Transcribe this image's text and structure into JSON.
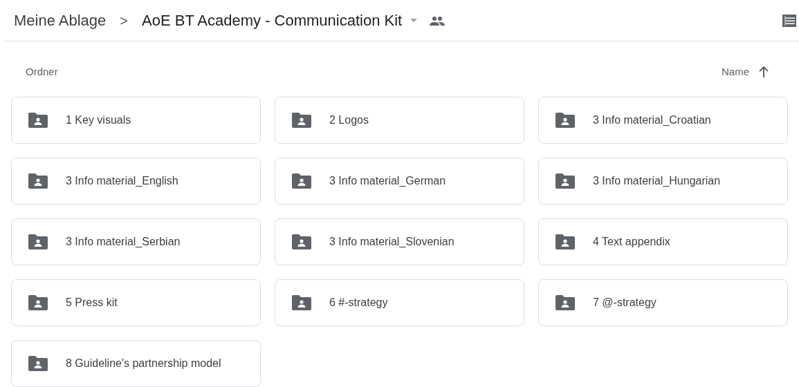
{
  "breadcrumb": {
    "root": "Meine Ablage",
    "separator": ">",
    "current": "AoE BT Academy - Communication Kit"
  },
  "section": {
    "title": "Ordner",
    "sort_label": "Name"
  },
  "folders": [
    {
      "name": "1 Key visuals"
    },
    {
      "name": "2 Logos"
    },
    {
      "name": "3 Info material_Croatian"
    },
    {
      "name": "3 Info material_English"
    },
    {
      "name": "3 Info material_German"
    },
    {
      "name": "3 Info material_Hungarian"
    },
    {
      "name": "3 Info material_Serbian"
    },
    {
      "name": "3 Info material_Slovenian"
    },
    {
      "name": "4 Text appendix"
    },
    {
      "name": "5 Press kit"
    },
    {
      "name": "6 #-strategy"
    },
    {
      "name": "7 @-strategy"
    },
    {
      "name": "8 Guideline's partnership model"
    }
  ]
}
